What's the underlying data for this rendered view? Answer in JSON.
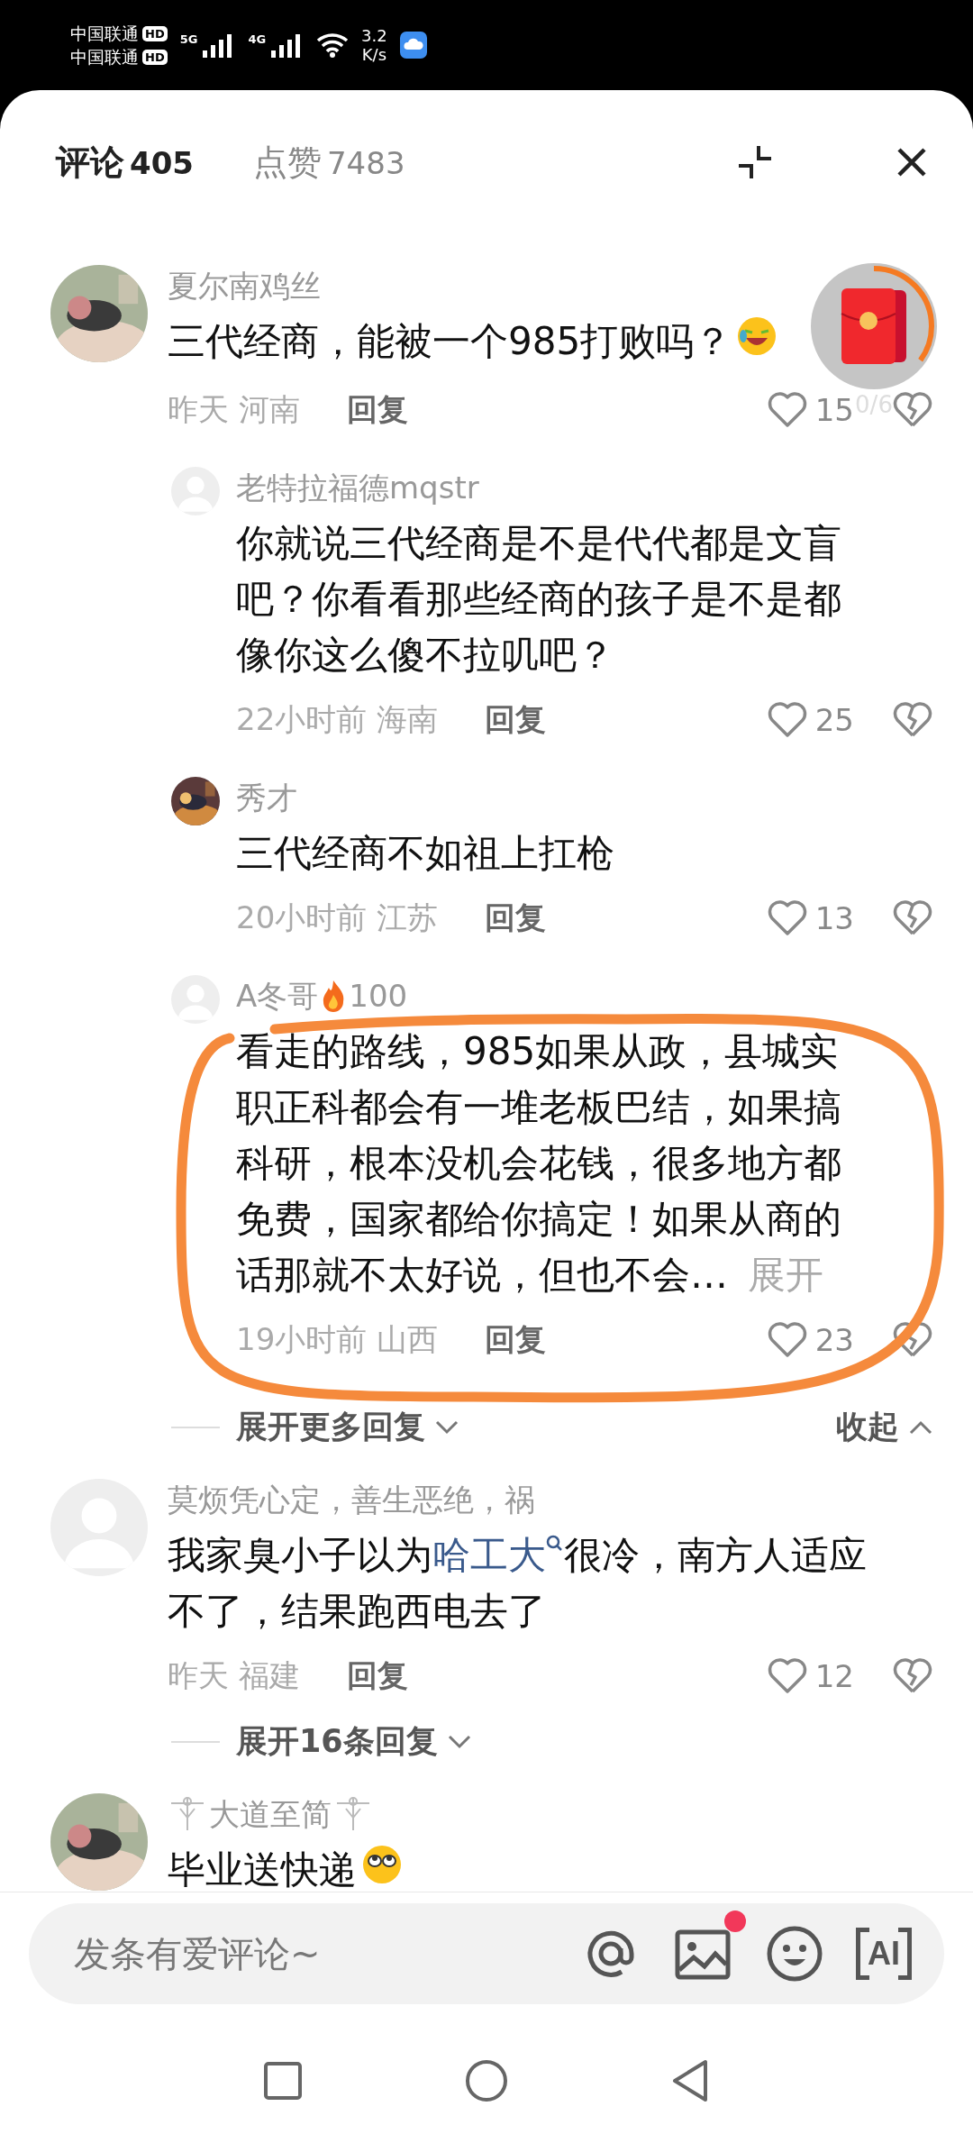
{
  "status_bar": {
    "carrier_1": "中国联通",
    "carrier_2": "中国联通",
    "hd_1": "HD",
    "hd_2": "HD",
    "network_1": "5G",
    "network_2": "4G",
    "speed_value": "3.2",
    "speed_unit": "K/s"
  },
  "header": {
    "tabs": [
      {
        "label": "评论",
        "count": "405",
        "selected": true
      },
      {
        "label": "点赞",
        "count": "7483",
        "selected": false
      }
    ]
  },
  "red_packet": {
    "progress": "0/6"
  },
  "comments": [
    {
      "avatar": {
        "kind": "picture"
      },
      "name": "夏尔南鸡丝",
      "segments": [
        {
          "kind": "plain",
          "text": "三代经商，能被一个985打败吗？"
        }
      ],
      "emoji": {
        "kind": "laugh"
      },
      "time": "昨天",
      "location": "河南",
      "reply": "回复",
      "likes": "15",
      "replies": [
        {
          "avatar": {
            "kind": "default"
          },
          "name": "老特拉福德mqstr",
          "segments": [
            {
              "kind": "plain",
              "text": "你就说三代经商是不是代代都是文盲吧？你看看那些经商的孩子是不是都像你这么傻不拉叽吧？"
            }
          ],
          "time": "22小时前",
          "location": "海南",
          "reply": "回复",
          "likes": "25"
        },
        {
          "avatar": {
            "kind": "picture"
          },
          "name": "秀才",
          "segments": [
            {
              "kind": "plain",
              "text": "三代经商不如祖上扛枪"
            }
          ],
          "time": "20小时前",
          "location": "江苏",
          "reply": "回复",
          "likes": "13"
        },
        {
          "avatar": {
            "kind": "default"
          },
          "name": "A冬哥",
          "fire_badge": "100",
          "segments": [
            {
              "kind": "plain",
              "text": "看走的路线，985如果从政，县城实职正科都会有一堆老板巴结，如果搞科研，根本没机会花钱，很多地方都免费，国家都给你搞定！如果从商的话那就不太好说，但也不会…"
            }
          ],
          "more": "展开",
          "circled": true,
          "time": "19小时前",
          "location": "山西",
          "reply": "回复",
          "likes": "23"
        }
      ],
      "expand_more": "展开更多回复",
      "collapse": "收起"
    },
    {
      "avatar": {
        "kind": "default"
      },
      "name": "莫烦凭心定，善生恶绝，祸",
      "segments": [
        {
          "kind": "plain",
          "text": "我家臭小子以为"
        },
        {
          "kind": "link",
          "text": "哈工大"
        },
        {
          "kind": "plain",
          "text": "很冷，南方人适应不了，结果跑西电去了"
        }
      ],
      "time": "昨天",
      "location": "福建",
      "reply": "回复",
      "likes": "12",
      "expand_more": "展开16条回复"
    },
    {
      "avatar": {
        "kind": "picture"
      },
      "name": "大道至简",
      "ornate": true,
      "segments": [
        {
          "kind": "plain",
          "text": "毕业送快递"
        }
      ],
      "emoji": {
        "kind": "rolling-eyes"
      }
    }
  ],
  "composer": {
    "placeholder": "发条有爱评论~",
    "image_badge": true,
    "ai_button": "AI"
  }
}
